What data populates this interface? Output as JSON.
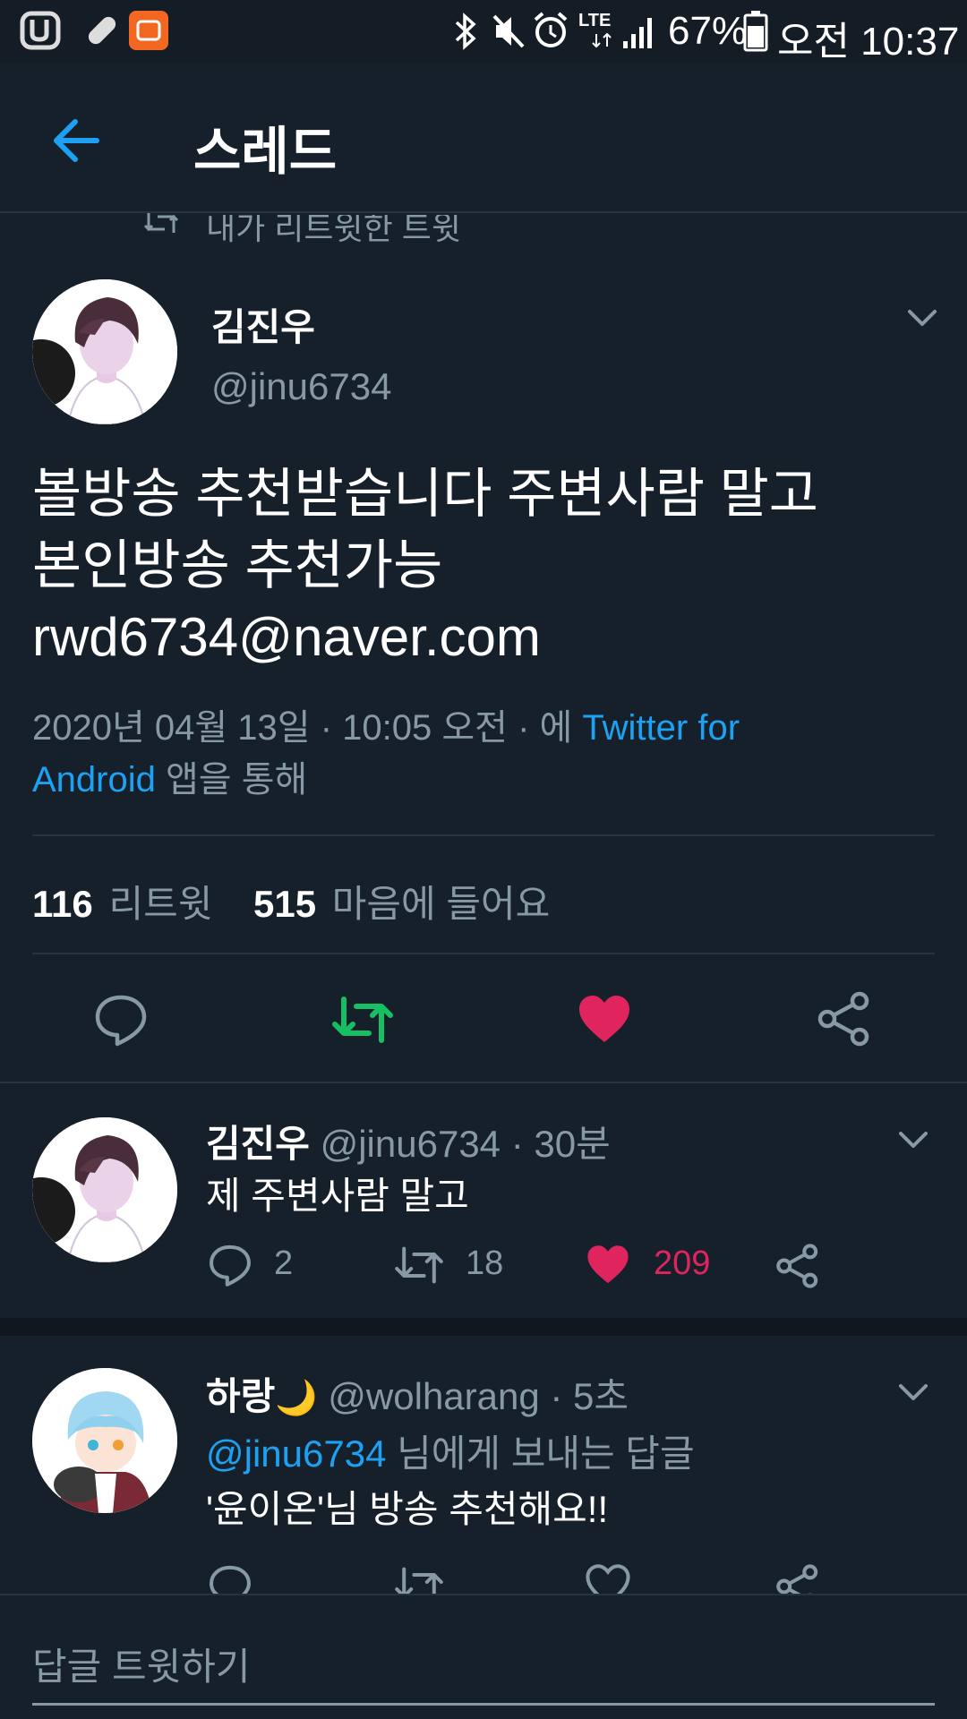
{
  "status_bar": {
    "lte": "LTE",
    "battery": "67%",
    "time": "오전 10:37",
    "icons": [
      "uplus-icon",
      "pill-icon",
      "mi-icon",
      "bluetooth-icon",
      "mute-icon",
      "alarm-icon",
      "signal-icon",
      "battery-icon"
    ]
  },
  "header": {
    "title": "스레드"
  },
  "main_tweet": {
    "retweet_note": "내가 리트윗한 트윗",
    "name": "김진우",
    "handle": "@jinu6734",
    "text_line1": "볼방송 추천받습니다 주변사람 말고",
    "text_line2": "본인방송 추천가능",
    "text_line3": "rwd6734@naver.com",
    "meta_date": "2020년 04월 13일 · 10:05 오전 · 에 ",
    "meta_source_part1": "Twitter for",
    "meta_source_part2": "Android",
    "meta_suffix": " 앱을 통해",
    "retweet_count": "116",
    "retweet_label": "리트윗",
    "like_count": "515",
    "like_label": "마음에 들어요"
  },
  "reply_1": {
    "name": "김진우",
    "handle": "@jinu6734",
    "time": "· 30분",
    "text": "제 주변사람 말고",
    "replies": "2",
    "retweets": "18",
    "likes": "209"
  },
  "reply_2": {
    "name": "하랑",
    "moon": "🌙",
    "handle": "@wolharang",
    "time": "· 5초",
    "reply_to_handle": "@jinu6734",
    "reply_to_suffix": " 님에게 보내는 답글",
    "text": "'윤이온'님 방송 추천해요!!"
  },
  "composer": {
    "placeholder": "답글 트윗하기"
  },
  "colors": {
    "background": "#15202b",
    "accent": "#1da1f2",
    "like": "#e0245e",
    "retweet": "#17bf63",
    "secondary": "#8899a6"
  }
}
